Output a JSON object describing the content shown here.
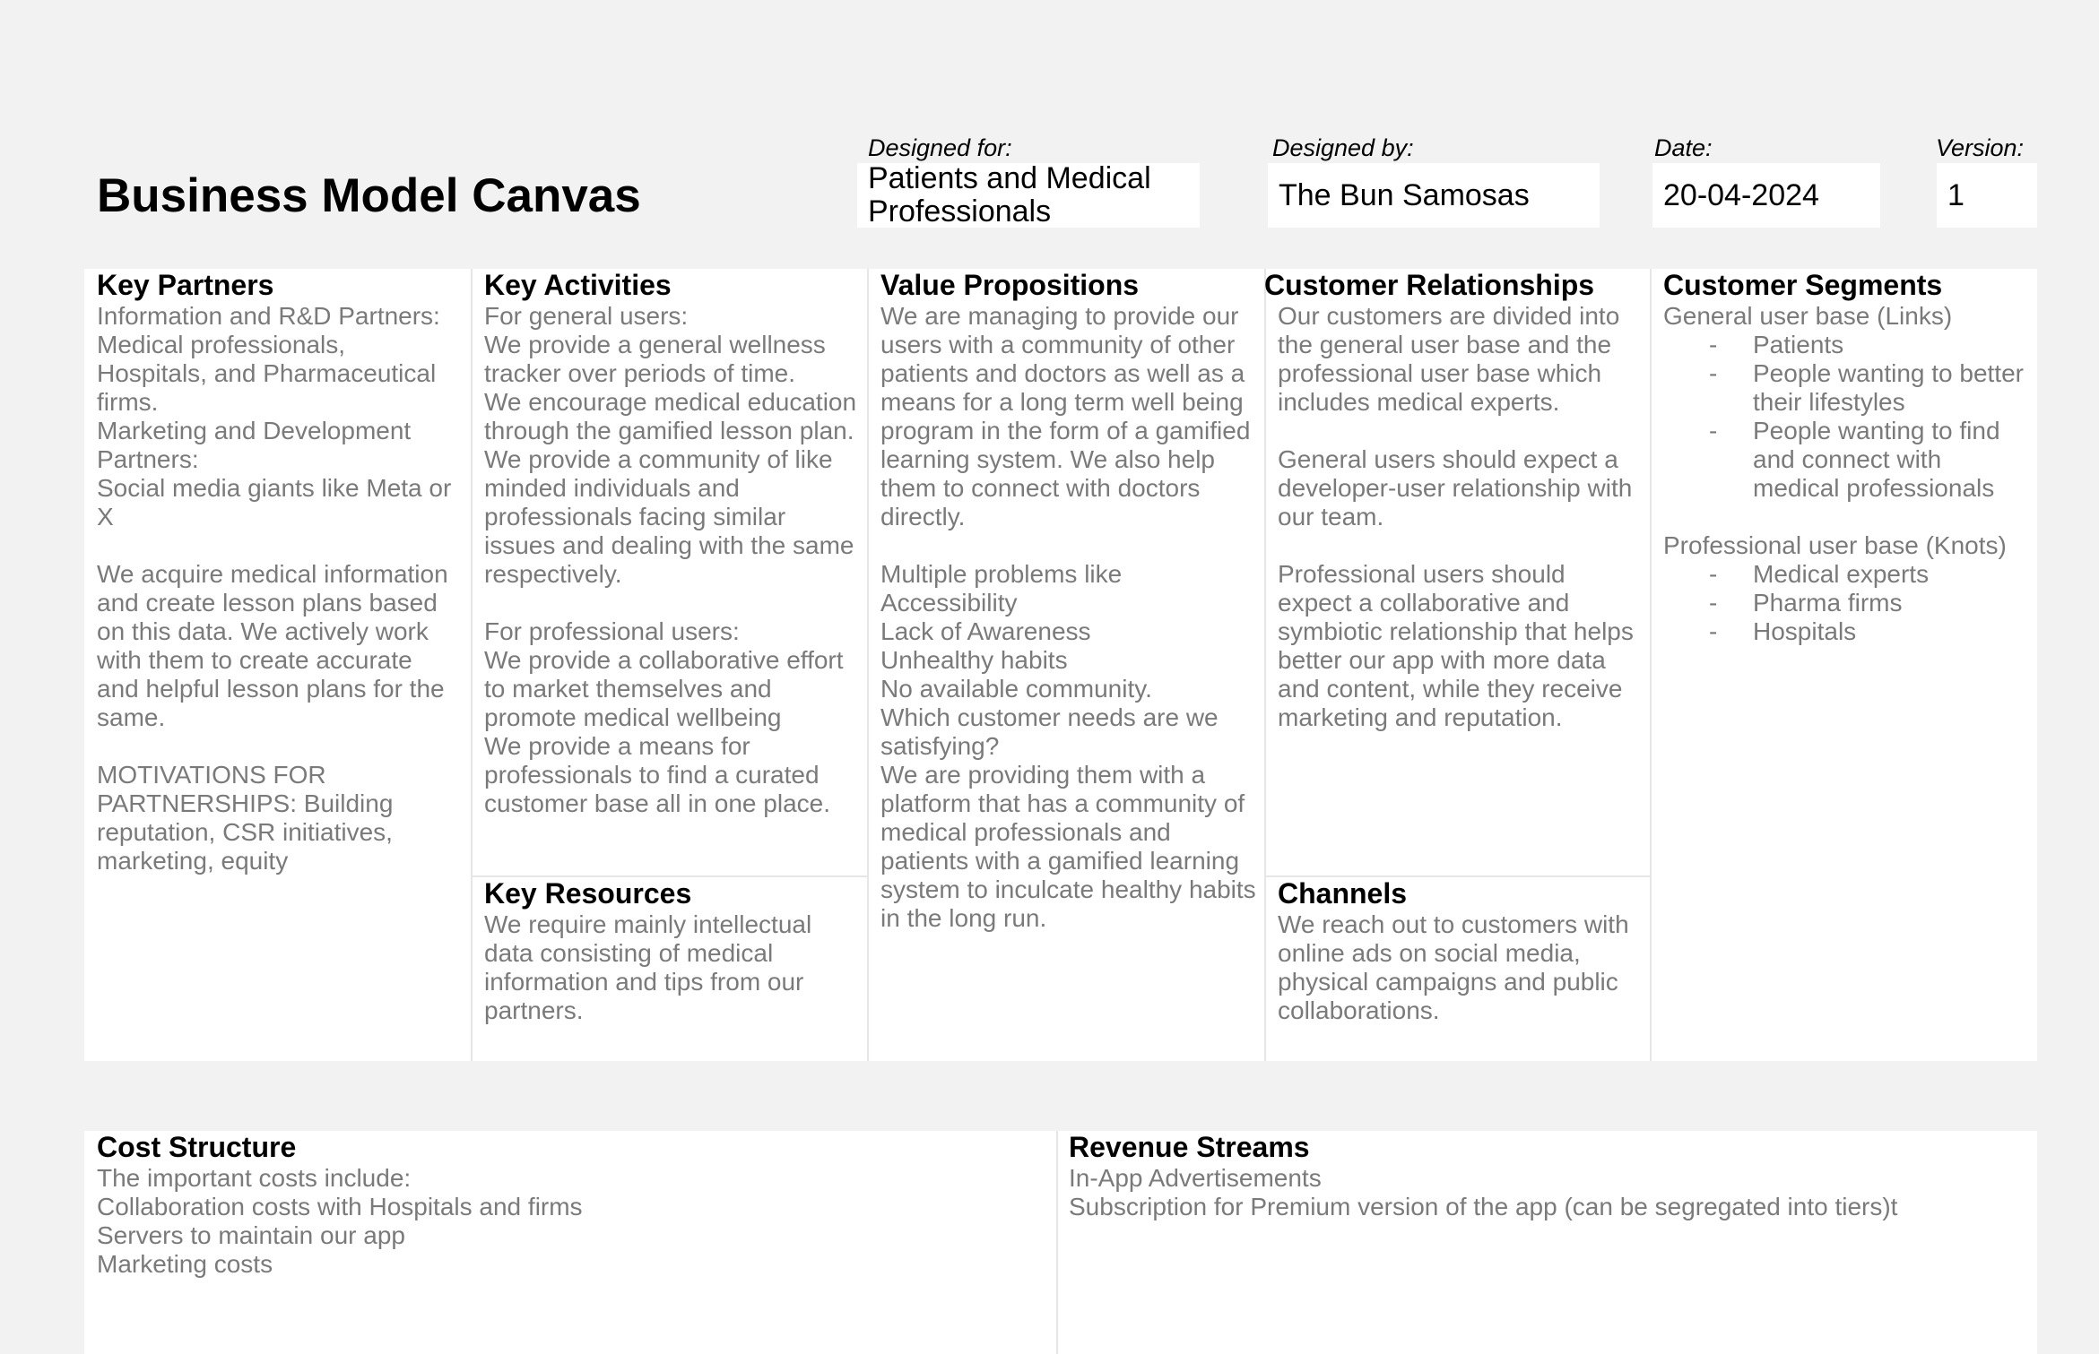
{
  "title": "Business Model Canvas",
  "meta": {
    "designed_for_label": "Designed for:",
    "designed_for_value": "Patients and Medical Professionals",
    "designed_by_label": "Designed by:",
    "designed_by_value": "The Bun Samosas",
    "date_label": "Date:",
    "date_value": "20-04-2024",
    "version_label": "Version:",
    "version_value": "1"
  },
  "key_partners": {
    "title": "Key Partners",
    "body": "Information and R&D Partners:\nMedical professionals, Hospitals, and Pharmaceutical firms.\nMarketing and Development Partners:\nSocial media giants like Meta or X\n\nWe acquire medical information and create lesson plans based on this data. We actively work with them to create accurate and helpful lesson plans for the same.\n\nMOTIVATIONS FOR PARTNERSHIPS: Building reputation, CSR initiatives, marketing, equity"
  },
  "key_activities": {
    "title": "Key Activities",
    "body": "For general users:\nWe provide a general wellness tracker over periods of time.\nWe encourage medical education through the gamified lesson plan.\nWe provide a community of like minded individuals and professionals facing similar issues and dealing with the same respectively.\n\nFor professional users:\nWe provide a collaborative effort to market themselves and promote medical wellbeing\nWe provide a means for professionals to find a curated customer base all in one place."
  },
  "key_resources": {
    "title": "Key Resources",
    "body": "We require mainly intellectual data consisting of medical information and tips from our partners."
  },
  "value_propositions": {
    "title": "Value Propositions",
    "body": "We are managing to provide our users with a community of other patients and doctors as well as a means for a long term well being program in the form of a gamified learning system. We also help them to connect with doctors directly.\n\nMultiple problems like\nAccessibility\nLack of Awareness\nUnhealthy habits\nNo available community.\n Which customer needs are we satisfying?\nWe are providing them with a platform that has a community of medical professionals and patients with a gamified learning system to inculcate healthy habits in the long run."
  },
  "customer_relationships": {
    "title": "Customer Relationships",
    "body": "Our customers are divided into the general user base and the professional user base which includes medical experts.\n\nGeneral users should expect a developer-user relationship with our team.\n\nProfessional users should expect a collaborative and symbiotic relationship that helps better our app with more data and content, while they receive marketing and reputation."
  },
  "channels": {
    "title": "Channels",
    "body": "We reach out to customers with online ads on social media, physical campaigns and public collaborations."
  },
  "customer_segments": {
    "title": "Customer Segments",
    "general_heading": "General user base (Links)",
    "general_items": [
      "Patients",
      "People wanting to better their lifestyles",
      "People wanting to find and connect with medical professionals"
    ],
    "professional_heading": "Professional user base (Knots)",
    "professional_items": [
      "Medical experts",
      "Pharma firms",
      "Hospitals"
    ]
  },
  "cost_structure": {
    "title": "Cost Structure",
    "body": "The important costs include:\nCollaboration costs with Hospitals and firms\nServers to maintain our app\nMarketing costs"
  },
  "revenue_streams": {
    "title": "Revenue Streams",
    "body": "In-App Advertisements\nSubscription for Premium version of the app (can be segregated into tiers)t"
  }
}
